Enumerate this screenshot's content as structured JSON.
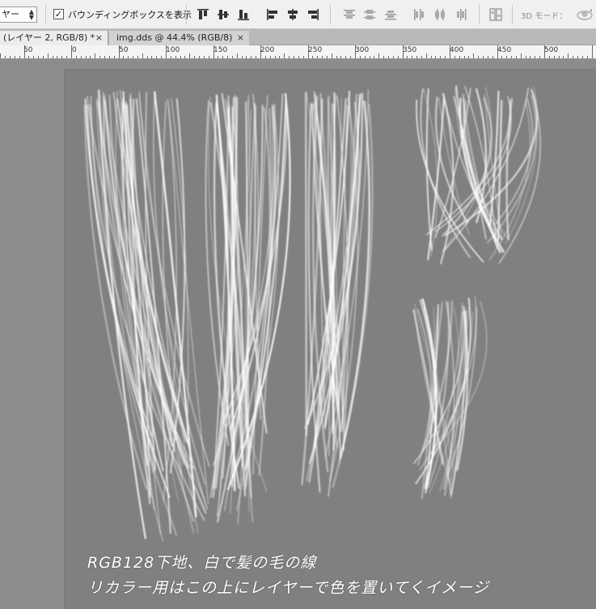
{
  "options_bar": {
    "layer_select_value": "ヤー",
    "bounding_box_checked_mark": "✓",
    "bounding_box_label": "バウンディングボックスを表示",
    "three_d_mode_label": "3D モード："
  },
  "tabs": [
    {
      "label": "(レイヤー 2, RGB/8) *",
      "close": "×"
    },
    {
      "label": "img.dds @ 44.4% (RGB/8)",
      "close": "×"
    }
  ],
  "ruler": {
    "labels": [
      "50",
      "0",
      "50",
      "100",
      "150",
      "200",
      "250",
      "300",
      "350",
      "400",
      "450",
      "500"
    ]
  },
  "canvas": {
    "background_color": "#808080",
    "caption_line1": "RGB128下地、白で髪の毛の線",
    "caption_line2": "リカラー用はこの上にレイヤーで色を置いてくイメージ"
  },
  "icons": {
    "align": [
      "align-top-edges-icon",
      "align-vertical-centers-icon",
      "align-bottom-edges-icon",
      "align-left-edges-icon",
      "align-horizontal-centers-icon",
      "align-right-edges-icon"
    ],
    "distribute": [
      "distribute-top-icon",
      "distribute-vertical-centers-icon",
      "distribute-bottom-icon",
      "distribute-left-icon",
      "distribute-horizontal-centers-icon",
      "distribute-right-icon"
    ],
    "auto_align": "auto-align-layers-icon",
    "orbit_3d": "orbit-3d-icon"
  }
}
